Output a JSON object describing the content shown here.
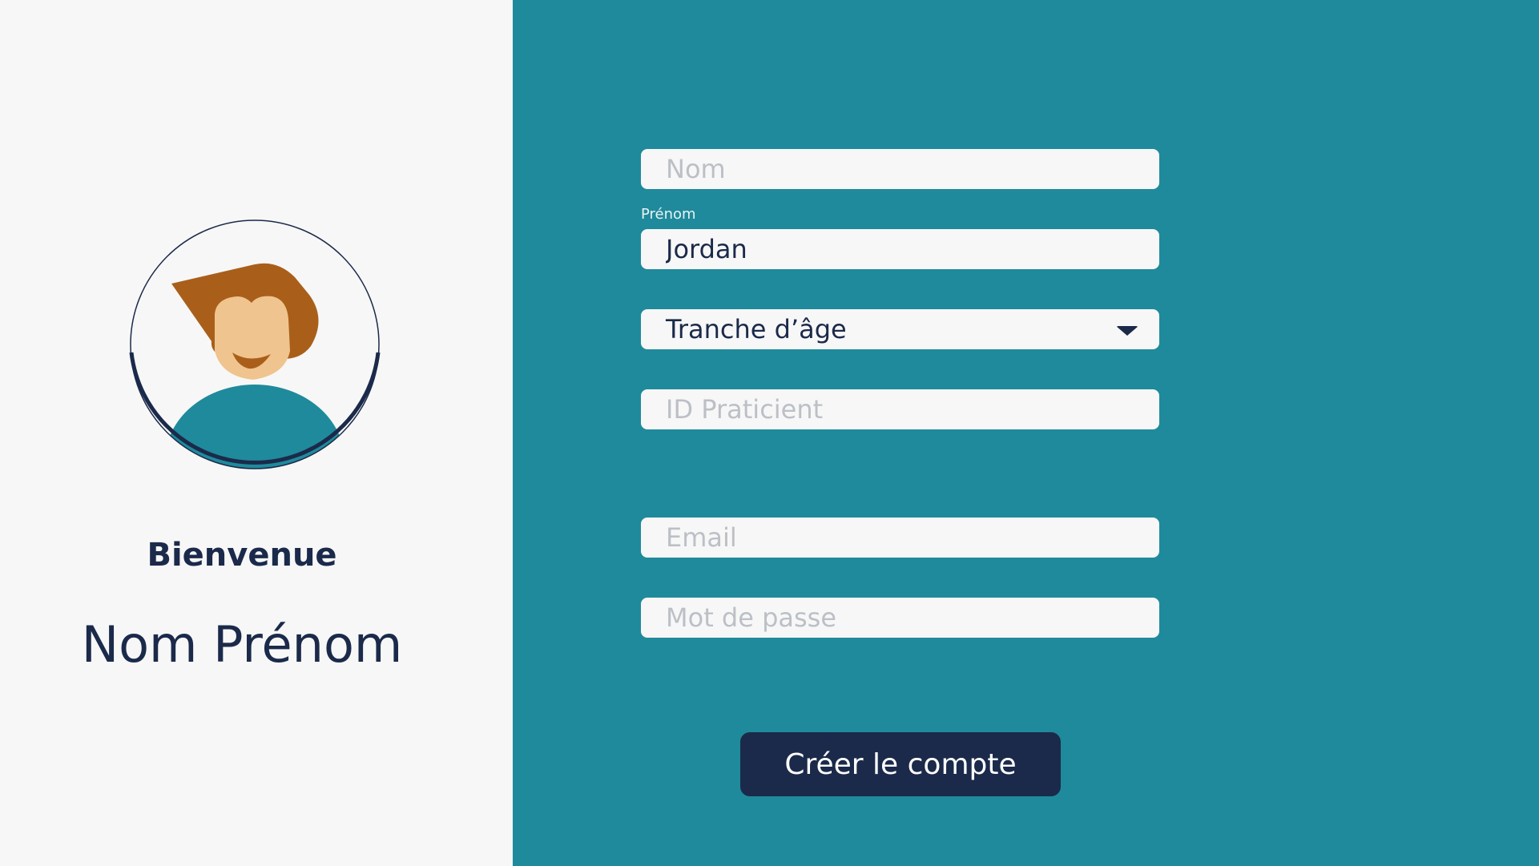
{
  "profile": {
    "welcome": "Bienvenue",
    "name": "Nom Prénom",
    "avatar_icon": "user-avatar-icon"
  },
  "form": {
    "nom": {
      "placeholder": "Nom",
      "value": ""
    },
    "prenom": {
      "label": "Prénom",
      "value": "Jordan"
    },
    "tranche_age": {
      "selected": "Tranche d’âge",
      "icon": "caret-down-icon"
    },
    "id_praticien": {
      "placeholder": "ID Praticient",
      "value": ""
    },
    "email": {
      "placeholder": "Email",
      "value": ""
    },
    "mot_de_passe": {
      "placeholder": "Mot de passe",
      "value": ""
    },
    "submit_label": "Créer le compte"
  },
  "colors": {
    "background_left": "#f7f7f7",
    "background_right": "#1f8a9b",
    "navy": "#1b2a4a",
    "hair": "#a95f1a",
    "skin": "#f0c48e",
    "shirt": "#1f8a9b"
  }
}
